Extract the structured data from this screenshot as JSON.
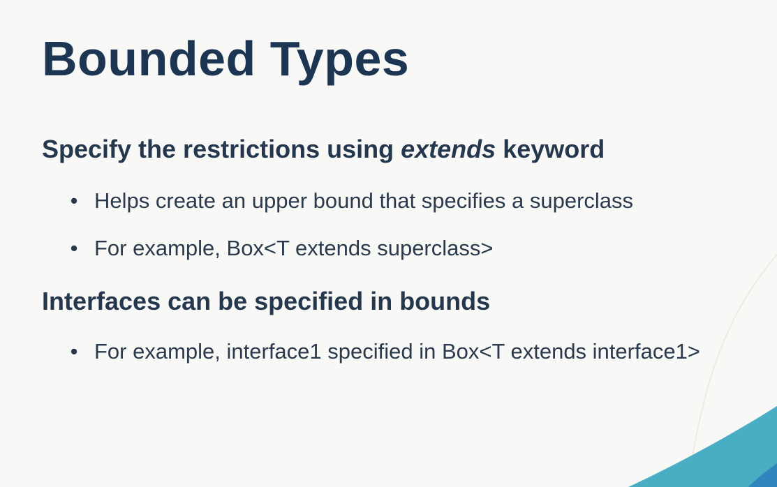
{
  "slide": {
    "title": "Bounded Types",
    "heading1": {
      "before": "Specify the restrictions using ",
      "emphasis": "extends",
      "after": " keyword"
    },
    "bullets1": [
      "Helps create an upper bound that specifies a superclass",
      "For example, Box<T extends superclass>"
    ],
    "heading2": "Interfaces can be specified in bounds",
    "bullets2": [
      "For example, interface1 specified in Box<T extends interface1>"
    ],
    "bullet_symbol": "•"
  },
  "colors": {
    "background": "#f8f8f7",
    "title": "#1c3553",
    "text": "#2a3a4c",
    "accent_teal": "#49aec3",
    "accent_blue": "#2f86bf"
  }
}
